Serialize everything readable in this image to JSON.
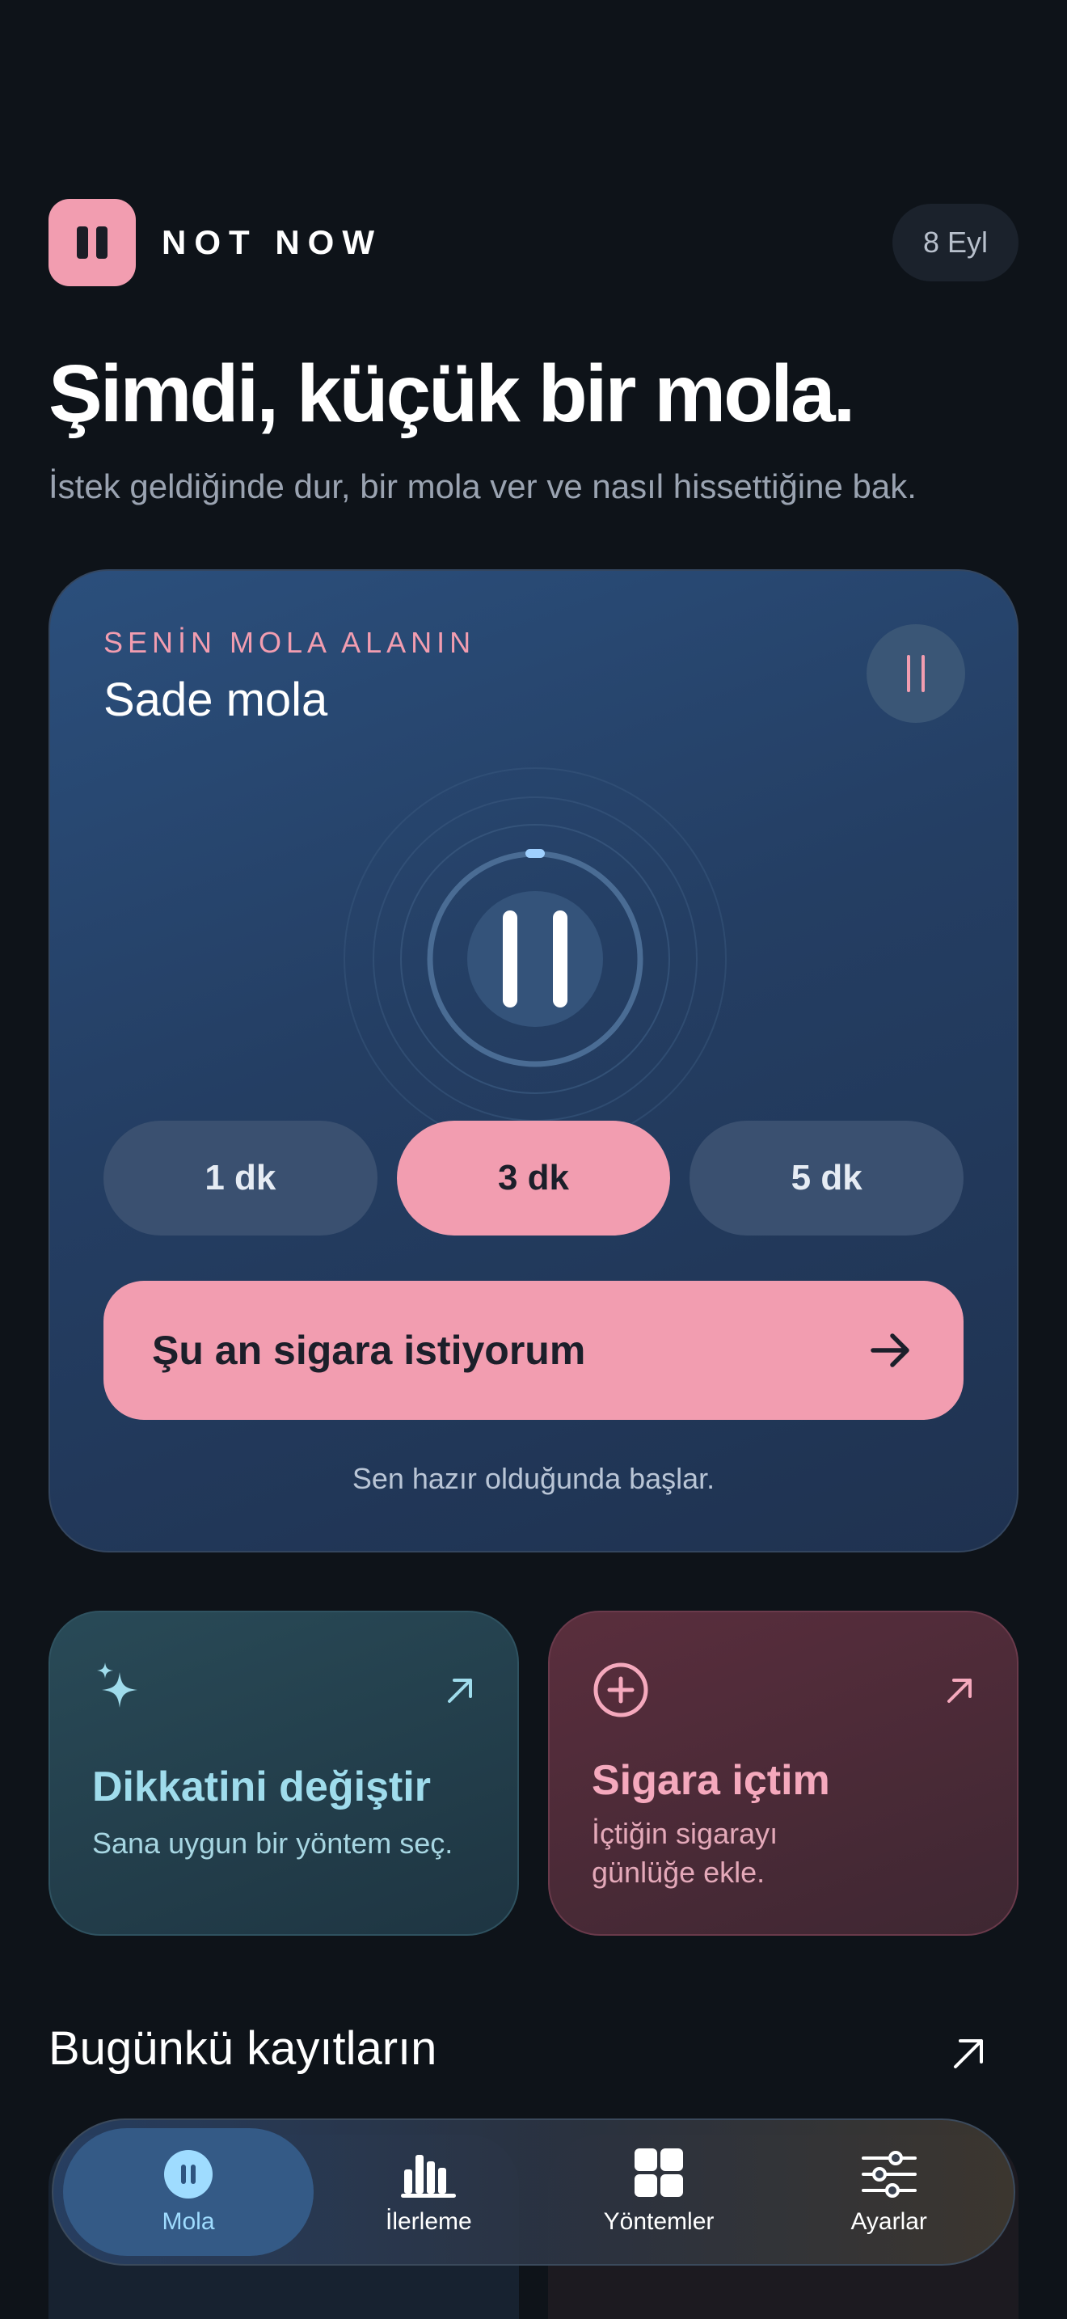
{
  "header": {
    "brand": "NOT NOW",
    "date": "8 Eyl"
  },
  "hero": {
    "title": "Şimdi, küçük bir mola.",
    "subtitle": "İstek geldiğinde dur, bir mola ver ve nasıl hissettiğine bak."
  },
  "main_card": {
    "eyebrow": "SENİN MOLA ALANIN",
    "title": "Sade mola",
    "durations": [
      {
        "label": "1 dk",
        "active": false
      },
      {
        "label": "3 dk",
        "active": true
      },
      {
        "label": "5 dk",
        "active": false
      }
    ],
    "cta_label": "Şu an sigara istiyorum",
    "footer": "Sen hazır olduğunda başlar."
  },
  "cards": {
    "distract": {
      "title": "Dikkatini değiştir",
      "desc": "Sana uygun bir yöntem seç."
    },
    "smoked": {
      "title": "Sigara içtim",
      "desc_line1": "İçtiğin sigarayı",
      "desc_line2": "günlüğe ekle."
    }
  },
  "today": {
    "title": "Bugünkü kayıtların"
  },
  "tabbar": {
    "tabs": [
      {
        "label": "Mola",
        "icon": "pause-circle-icon",
        "active": true
      },
      {
        "label": "İlerleme",
        "icon": "bar-chart-icon",
        "active": false
      },
      {
        "label": "Yöntemler",
        "icon": "grid-icon",
        "active": false
      },
      {
        "label": "Ayarlar",
        "icon": "sliders-icon",
        "active": false
      }
    ]
  },
  "colors": {
    "accent_pink": "#f29db0",
    "accent_cyan": "#9fdcec",
    "background": "#0e1319",
    "card_blue": "#2b4f7c"
  }
}
